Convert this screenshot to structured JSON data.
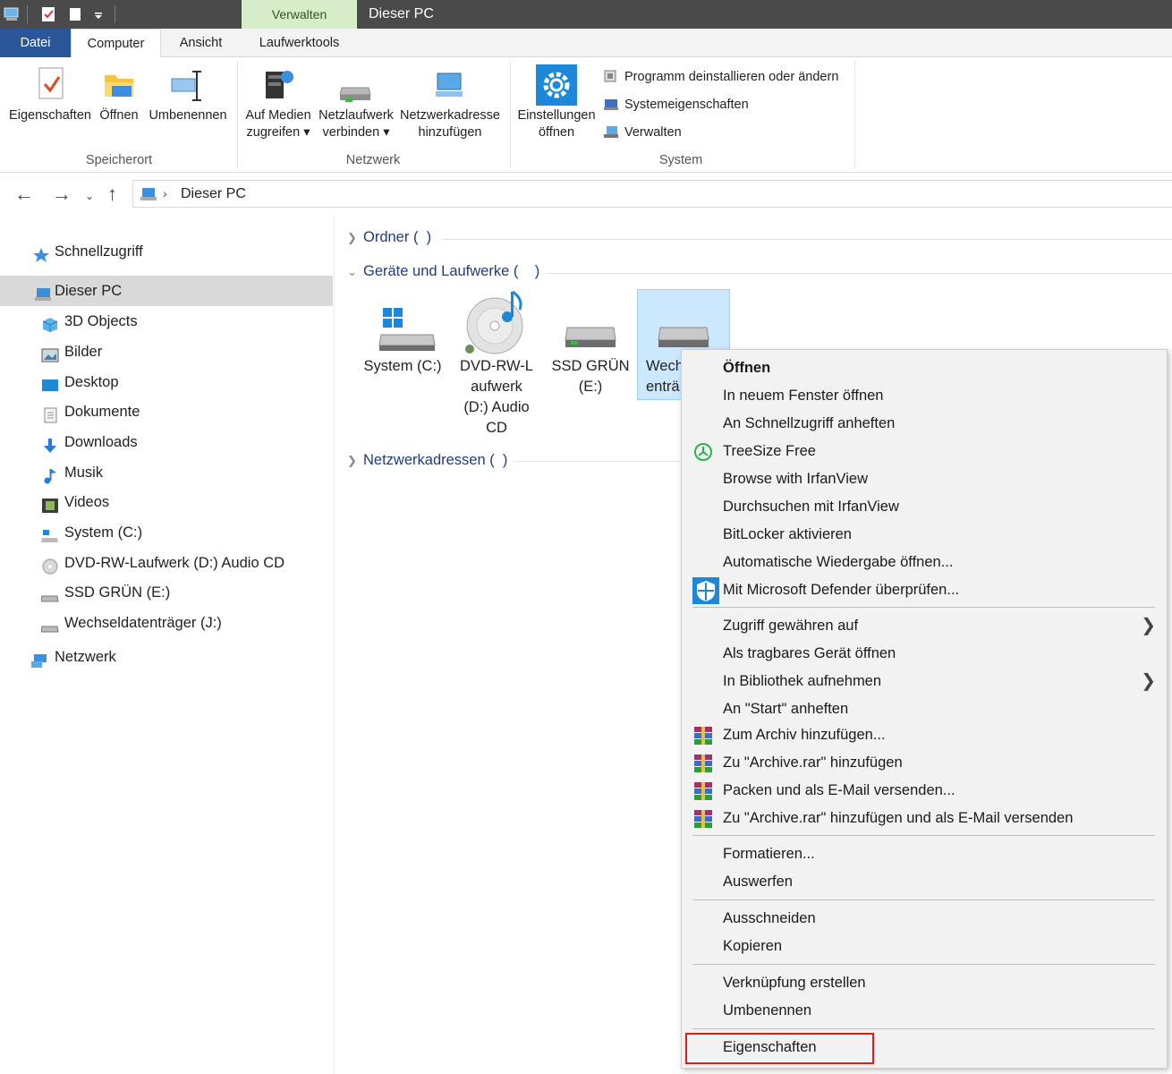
{
  "titlebar": {
    "context_tab": "Verwalten",
    "title": "Dieser PC"
  },
  "tabs": {
    "datei": "Datei",
    "computer": "Computer",
    "ansicht": "Ansicht",
    "laufwerktools": "Laufwerktools"
  },
  "ribbon": {
    "speicherort": {
      "label": "Speicherort",
      "eigenschaften": "Eigenschaften",
      "oeffnen": "Öffnen",
      "umbenennen": "Umbenennen"
    },
    "netzwerk": {
      "label": "Netzwerk",
      "medien_l1": "Auf Medien",
      "medien_l2": "zugreifen ▾",
      "netzlaufwerk_l1": "Netzlaufwerk",
      "netzlaufwerk_l2": "verbinden ▾",
      "netzadresse_l1": "Netzwerkadresse",
      "netzadresse_l2": "hinzufügen"
    },
    "system": {
      "label": "System",
      "einstellungen_l1": "Einstellungen",
      "einstellungen_l2": "öffnen",
      "programm": "Programm deinstallieren oder ändern",
      "systemeigenschaften": "Systemeigenschaften",
      "verwalten": "Verwalten"
    }
  },
  "address": {
    "path": "Dieser PC"
  },
  "sidebar": {
    "items": [
      {
        "label": "Schnellzugriff"
      },
      {
        "label": "Dieser PC"
      },
      {
        "label": "3D Objects"
      },
      {
        "label": "Bilder"
      },
      {
        "label": "Desktop"
      },
      {
        "label": "Dokumente"
      },
      {
        "label": "Downloads"
      },
      {
        "label": "Musik"
      },
      {
        "label": "Videos"
      },
      {
        "label": "System (C:)"
      },
      {
        "label": "DVD-RW-Laufwerk (D:) Audio CD"
      },
      {
        "label": "SSD GRÜN (E:)"
      },
      {
        "label": "Wechseldatenträger (J:)"
      },
      {
        "label": "Netzwerk"
      }
    ]
  },
  "content": {
    "sections": {
      "ordner": "Ordner",
      "geraete": "Geräte und Laufwerke",
      "netzwerkadressen": "Netzwerkadressen"
    },
    "drives": [
      {
        "l1": "System (C:)",
        "l2": ""
      },
      {
        "l1": "DVD-RW-L",
        "l2": "aufwerk",
        "l3": "(D:) Audio",
        "l4": "CD"
      },
      {
        "l1": "SSD GRÜN",
        "l2": "(E:)"
      },
      {
        "l1": "Wech",
        "l2": "enträ"
      }
    ]
  },
  "context_menu": {
    "items": [
      "Öffnen",
      "In neuem Fenster öffnen",
      "An Schnellzugriff anheften",
      "TreeSize Free",
      "Browse with IrfanView",
      "Durchsuchen mit IrfanView",
      "BitLocker aktivieren",
      "Automatische Wiedergabe öffnen...",
      "Mit Microsoft Defender überprüfen...",
      "Zugriff gewähren auf",
      "Als tragbares Gerät öffnen",
      "In Bibliothek aufnehmen",
      "An \"Start\" anheften",
      "Zum Archiv hinzufügen...",
      "Zu \"Archive.rar\" hinzufügen",
      "Packen und als E-Mail versenden...",
      "Zu \"Archive.rar\" hinzufügen und als E-Mail versenden",
      "Formatieren...",
      "Auswerfen",
      "Ausschneiden",
      "Kopieren",
      "Verknüpfung erstellen",
      "Umbenennen",
      "Eigenschaften"
    ]
  },
  "colors": {
    "accent": "#2b579a",
    "context_tab": "#d7ecc9",
    "selection": "#cce8ff",
    "highlight_box": "#e01b1b"
  }
}
